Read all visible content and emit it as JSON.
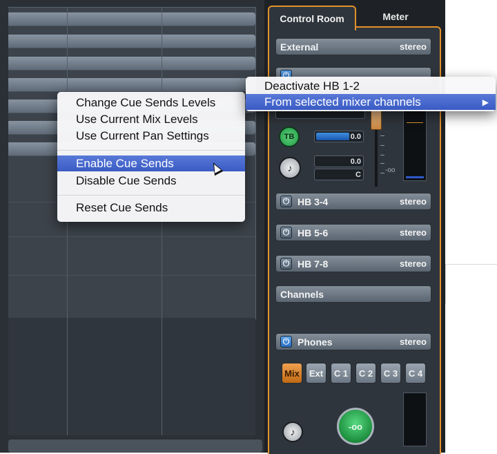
{
  "tabs": [
    {
      "label": "Control Room",
      "active": true
    },
    {
      "label": "Meter",
      "active": false
    }
  ],
  "rows": {
    "external": {
      "label": "External",
      "format": "stereo"
    },
    "hb34": {
      "label": "HB 3-4",
      "format": "stereo"
    },
    "hb56": {
      "label": "HB 5-6",
      "format": "stereo"
    },
    "hb78": {
      "label": "HB 7-8",
      "format": "stereo"
    },
    "channels": {
      "label": "Channels"
    },
    "phones": {
      "label": "Phones",
      "format": "stereo"
    }
  },
  "controls": {
    "talkback_label": "TB",
    "level_value": "0.0",
    "level2_value": "0.0",
    "pan_value": "C",
    "fader_scale_label": "-oo",
    "knob_value": "-oo"
  },
  "source_buttons": [
    {
      "label": "Mix",
      "active": true
    },
    {
      "label": "Ext",
      "active": false
    },
    {
      "label": "C 1",
      "active": false
    },
    {
      "label": "C 2",
      "active": false
    },
    {
      "label": "C 3",
      "active": false
    },
    {
      "label": "C 4",
      "active": false
    }
  ],
  "context_menu": {
    "items": [
      "Change Cue Sends Levels",
      "Use Current Mix Levels",
      "Use Current Pan Settings",
      "Enable Cue Sends",
      "Disable Cue Sends",
      "Reset Cue Sends"
    ],
    "highlighted": "Enable Cue Sends"
  },
  "submenu": {
    "items": [
      "Deactivate HB 1-2",
      "From selected mixer channels"
    ],
    "highlighted": "From selected mixer channels"
  },
  "colors": {
    "accent": "#e3912b",
    "highlight": "#3a5bc4",
    "talkback_green": "#1f9a45",
    "level_blue": "#1b58b0"
  },
  "icons": [
    "power-icon",
    "talkback-icon",
    "submenu-arrow-icon",
    "mouse-cursor-icon"
  ]
}
